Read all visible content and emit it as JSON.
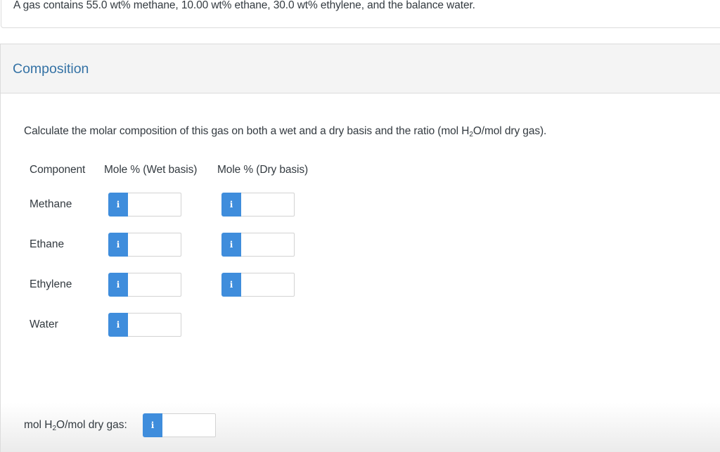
{
  "question": {
    "text": "A gas contains 55.0 wt% methane, 10.00 wt% ethane, 30.0 wt% ethylene, and the balance water."
  },
  "panel": {
    "title": "Composition",
    "prompt_before": "Calculate the molar composition of this gas on both a wet and a dry basis and the ratio (mol H",
    "prompt_sub": "2",
    "prompt_after": "O/mol dry gas).",
    "columns": [
      "Component",
      "Mole % (Wet basis)",
      "Mole % (Dry basis)"
    ],
    "rows": [
      {
        "component": "Methane",
        "wet_value": "",
        "dry_value": "",
        "has_dry": true
      },
      {
        "component": "Ethane",
        "wet_value": "",
        "dry_value": "",
        "has_dry": true
      },
      {
        "component": "Ethylene",
        "wet_value": "",
        "dry_value": "",
        "has_dry": true
      },
      {
        "component": "Water",
        "wet_value": "",
        "has_dry": false
      }
    ],
    "info_icon_glyph": "i",
    "ratio": {
      "label_before": "mol H",
      "label_sub": "2",
      "label_after": "O/mol dry gas:",
      "value": ""
    }
  },
  "colors": {
    "accent_blue": "#3f8ddc",
    "title_blue": "#3472a5",
    "text": "#333a40"
  }
}
